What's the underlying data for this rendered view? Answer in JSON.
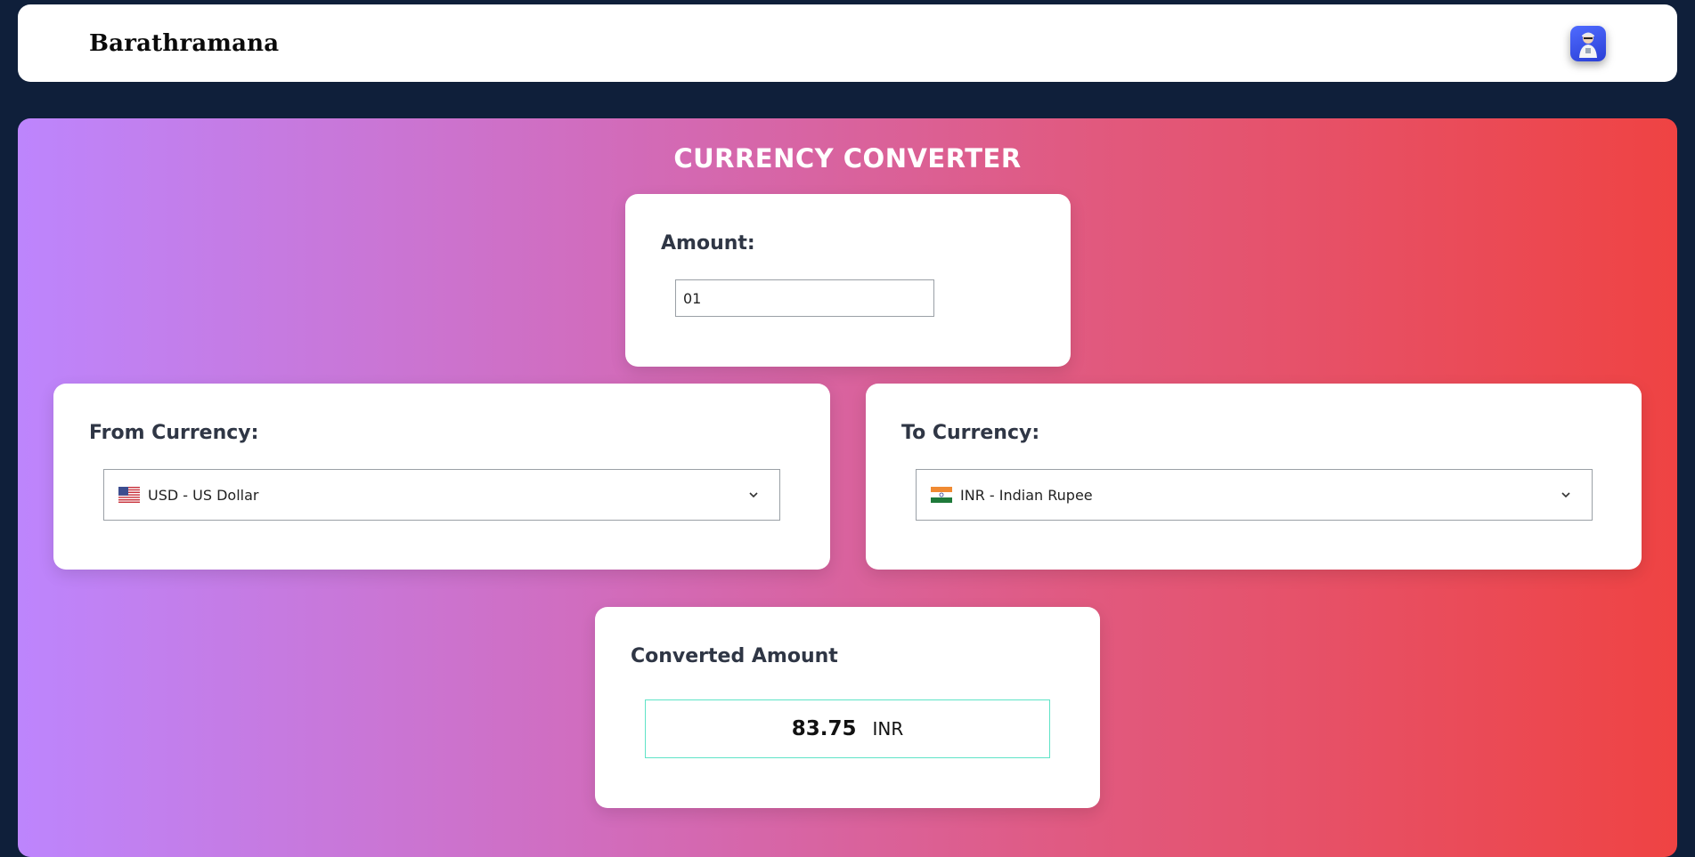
{
  "header": {
    "brand": "Barathramana",
    "avatar_icon": "user-avatar-icon"
  },
  "converter": {
    "title": "CURRENCY CONVERTER",
    "amount": {
      "label": "Amount:",
      "value": "01"
    },
    "from": {
      "label": "From Currency:",
      "selected": "USD - US Dollar",
      "flag_icon": "us-flag-icon"
    },
    "to": {
      "label": "To Currency:",
      "selected": "INR - Indian Rupee",
      "flag_icon": "india-flag-icon"
    },
    "result": {
      "label": "Converted Amount",
      "value": "83.75",
      "currency": "INR"
    }
  },
  "colors": {
    "page_background": "#0f1f3a",
    "gradient_start": "#bd85fd",
    "gradient_end": "#ef4343",
    "result_border": "#5fe3c7"
  }
}
